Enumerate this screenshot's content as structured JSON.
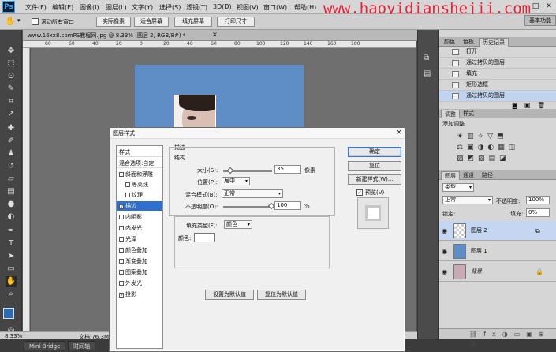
{
  "app": {
    "logo": "Ps"
  },
  "menu": [
    "文件(F)",
    "编辑(E)",
    "图像(I)",
    "图层(L)",
    "文字(Y)",
    "选择(S)",
    "滤镜(T)",
    "3D(D)",
    "视图(V)",
    "窗口(W)",
    "帮助(H)"
  ],
  "watermark": "www.haoyidianshejii.com",
  "window_controls": [
    "—",
    "□",
    "✕"
  ],
  "options": {
    "checkbox_label": "滚动所有窗口",
    "b1": "实际像素",
    "b2": "适合屏幕",
    "b3": "填充屏幕",
    "b4": "打印尺寸"
  },
  "document": {
    "tab_title": "www.16xx8.comPS教程网.jpg @ 8.33% (图层 2, RGB/8#) *",
    "tab_close": "×"
  },
  "ruler": {
    "h": [
      "80",
      "60",
      "40",
      "20",
      "0",
      "20",
      "40",
      "60",
      "80",
      "100",
      "120",
      "140",
      "160",
      "180"
    ]
  },
  "status": {
    "zoom": "8.33%",
    "doc": "文档:76.3M/7..."
  },
  "bottom_tabs": [
    "Mini Bridge",
    "时间轴"
  ],
  "panels": {
    "workspace_label": "基本功能",
    "history_tabs": [
      "颜色",
      "色板",
      "历史记录"
    ],
    "history": [
      "打开",
      "通过拷贝的图层",
      "填充",
      "矩形选框",
      "通过拷贝的图层"
    ],
    "adjust_tabs": [
      "调整",
      "样式"
    ],
    "adjust_label": "添加调整",
    "layer_tabs": [
      "图层",
      "通道",
      "路径"
    ],
    "layer_kind": "类型",
    "blend_mode": "正常",
    "opacity_label": "不透明度:",
    "opacity_value": "100%",
    "lock_label": "锁定:",
    "fill_label": "填充:",
    "fill_value": "0%",
    "layers": [
      "图层 2",
      "图层 1",
      "背景"
    ]
  },
  "dialog": {
    "title": "图层样式",
    "close": "×",
    "style_header": "样式",
    "blend_options": "混合选项:自定",
    "styles": [
      "斜面和浮雕",
      "等高线",
      "纹理",
      "描边",
      "内阴影",
      "内发光",
      "光泽",
      "颜色叠加",
      "渐变叠加",
      "图案叠加",
      "外发光",
      "投影"
    ],
    "section_stroke": "描边",
    "section_structure": "结构",
    "size_label": "大小(S):",
    "size_value": "35",
    "size_unit": "像素",
    "position_label": "位置(P):",
    "position_value": "居中",
    "blend_label": "混合模式(B):",
    "blend_value": "正常",
    "opacity_label": "不透明度(O):",
    "opacity_value": "100",
    "opacity_unit": "%",
    "filltype_label": "填充类型(F):",
    "filltype_value": "颜色",
    "color_label": "颜色:",
    "btn_default": "设置为默认值",
    "btn_reset_default": "复位为默认值",
    "btn_ok": "确定",
    "btn_reset": "复位",
    "btn_new_style": "新建样式(W)...",
    "preview_label": "预览(V)"
  }
}
